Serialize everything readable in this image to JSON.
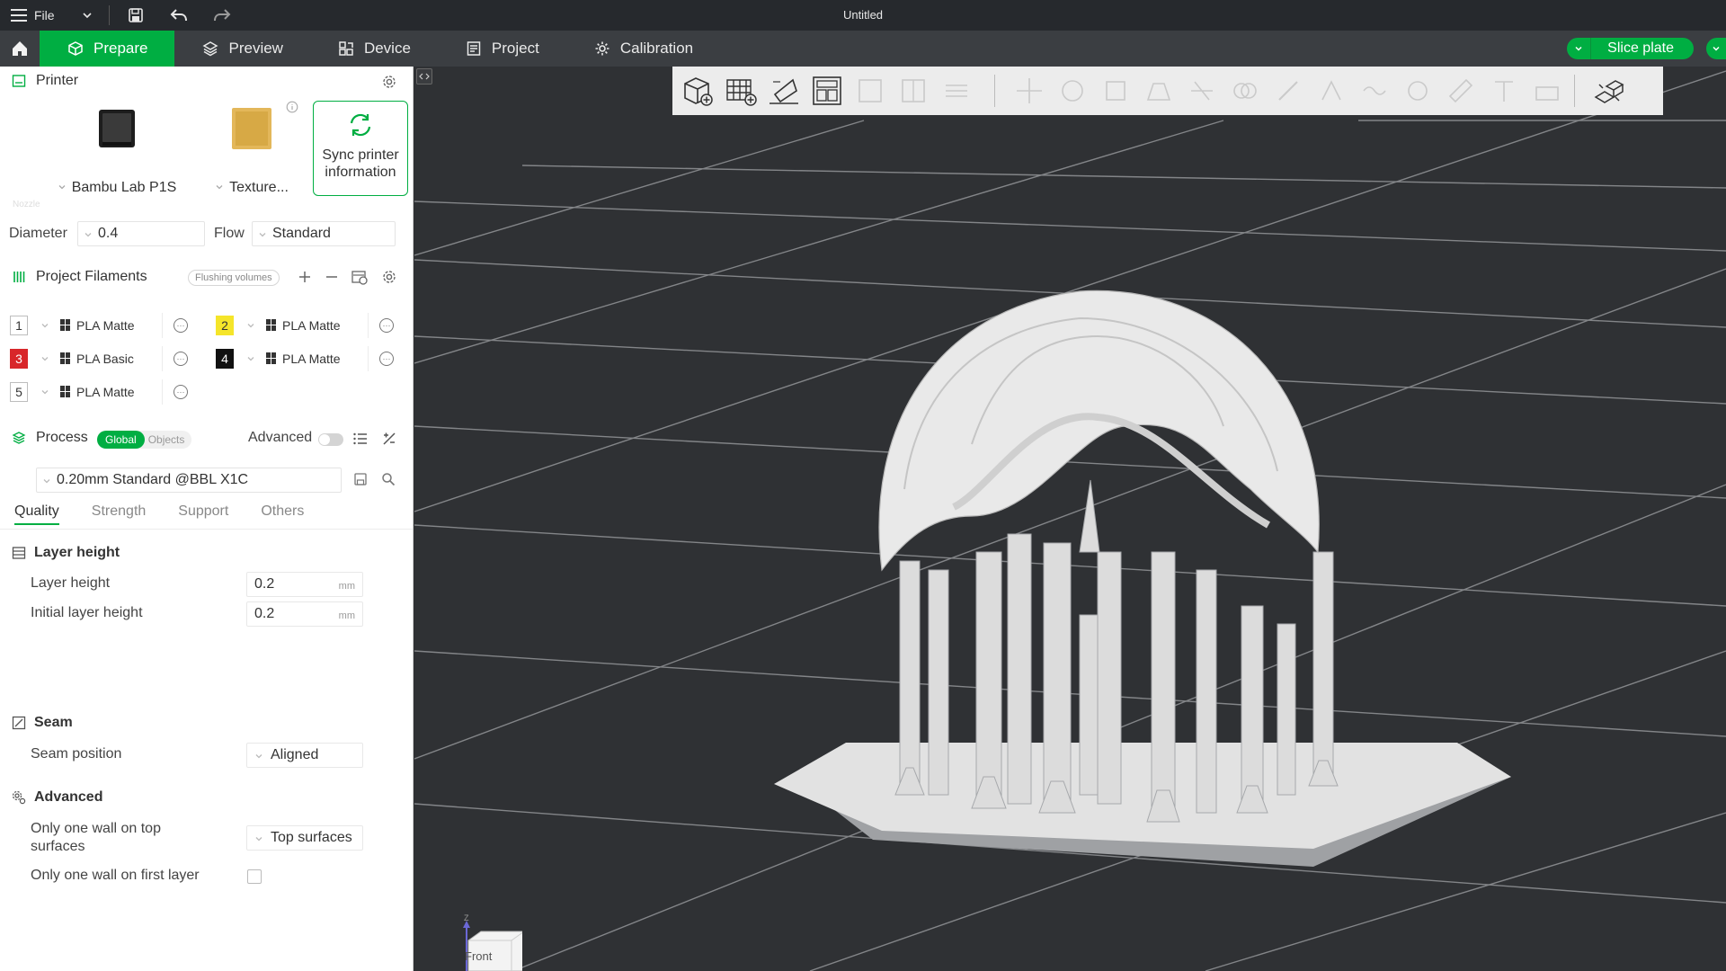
{
  "app": {
    "window_title": "Untitled",
    "file_menu": "File"
  },
  "nav": {
    "tabs": [
      {
        "label": "Prepare",
        "icon": "cube-icon"
      },
      {
        "label": "Preview",
        "icon": "layers-icon"
      },
      {
        "label": "Device",
        "icon": "device-icon"
      },
      {
        "label": "Project",
        "icon": "project-icon"
      },
      {
        "label": "Calibration",
        "icon": "gear-icon"
      }
    ],
    "active_tab": "Prepare",
    "slice_button": "Slice plate"
  },
  "printer": {
    "section_title": "Printer",
    "printer_name": "Bambu Lab P1S",
    "plate_name": "Texture...",
    "sync_label": "Sync printer information",
    "nozzle_label": "Nozzle",
    "diameter_label": "Diameter",
    "diameter_value": "0.4",
    "flow_label": "Flow",
    "flow_value": "Standard"
  },
  "filaments": {
    "section_title": "Project Filaments",
    "flushing_button": "Flushing volumes",
    "items": [
      {
        "num": "1",
        "name": "PLA Matte",
        "color": "#ffffff",
        "text_color": "#333333"
      },
      {
        "num": "2",
        "name": "PLA Matte",
        "color": "#f5e52a",
        "text_color": "#333333"
      },
      {
        "num": "3",
        "name": "PLA Basic",
        "color": "#d8262a",
        "text_color": "#ffffff"
      },
      {
        "num": "4",
        "name": "PLA Matte",
        "color": "#111111",
        "text_color": "#ffffff"
      },
      {
        "num": "5",
        "name": "PLA Matte",
        "color": "#ffffff",
        "text_color": "#333333"
      }
    ]
  },
  "process": {
    "section_title": "Process",
    "global_label": "Global",
    "objects_label": "Objects",
    "advanced_label": "Advanced",
    "advanced_on": false,
    "profile": "0.20mm Standard @BBL X1C",
    "tabs": [
      "Quality",
      "Strength",
      "Support",
      "Others"
    ],
    "active_tab": "Quality"
  },
  "quality": {
    "layer_height_group": "Layer height",
    "layer_height_label": "Layer height",
    "layer_height_value": "0.2",
    "initial_layer_height_label": "Initial layer height",
    "initial_layer_height_value": "0.2",
    "unit": "mm",
    "seam_group": "Seam",
    "seam_position_label": "Seam position",
    "seam_position_value": "Aligned",
    "advanced_group": "Advanced",
    "one_wall_top_label": "Only one wall on top surfaces",
    "one_wall_top_value": "Top surfaces",
    "one_wall_first_label": "Only one wall on first layer",
    "one_wall_first_checked": false
  },
  "viewport": {
    "axis_label": "Z",
    "view_cube_label": "Front"
  },
  "colors": {
    "accent": "#00ae42",
    "titlebar": "#26292d",
    "navbar": "#3b3e42",
    "viewport_bg": "#2f3134"
  }
}
